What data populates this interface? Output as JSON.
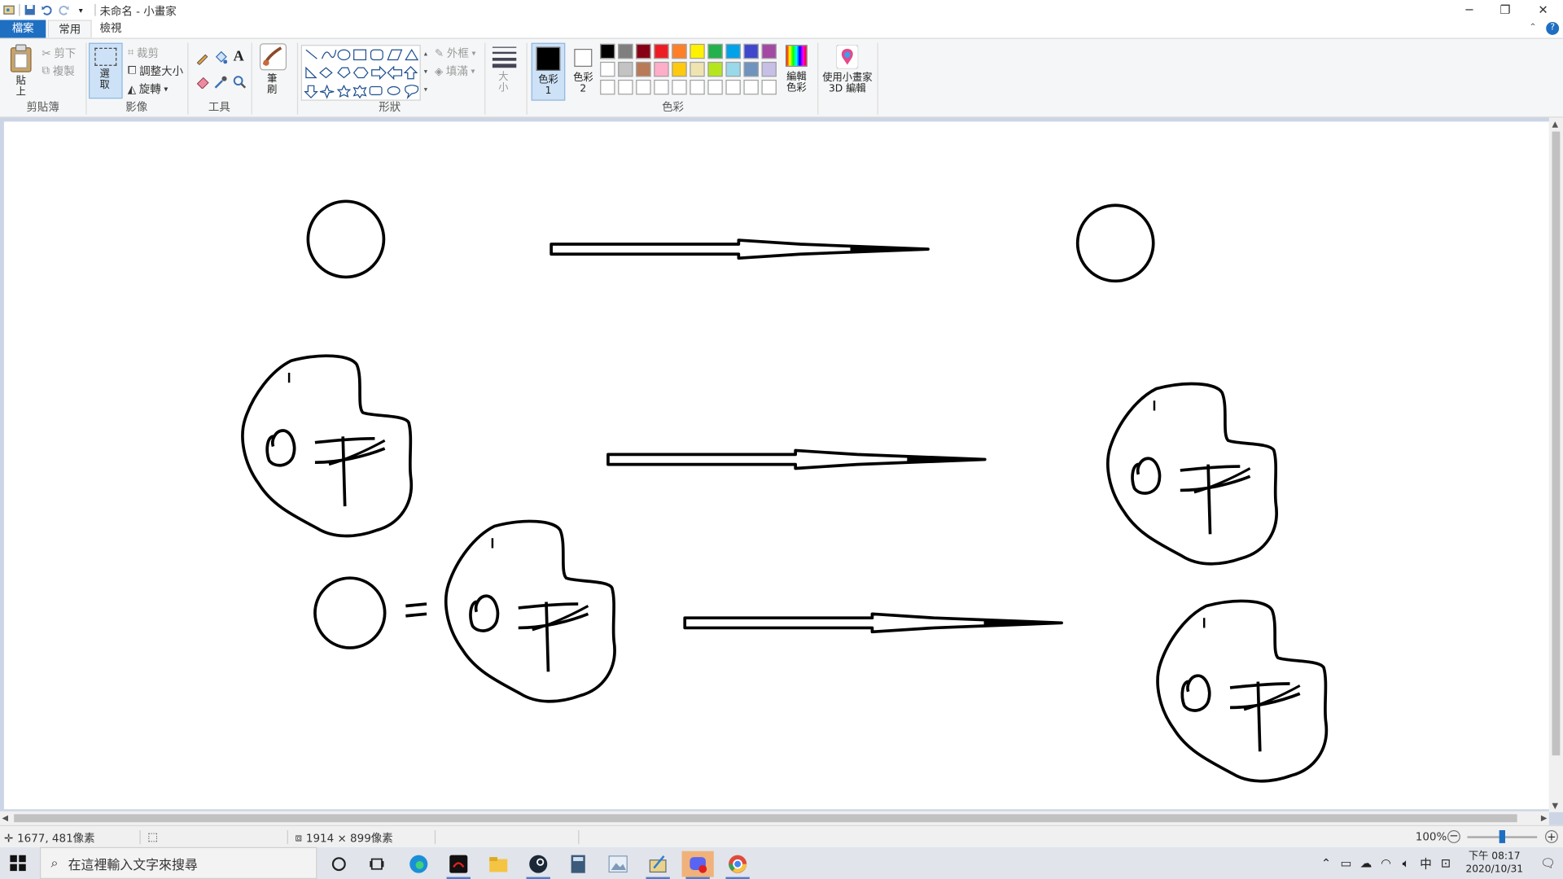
{
  "window": {
    "title": "未命名 - 小畫家",
    "minimize": "─",
    "restore": "❐",
    "close": "✕"
  },
  "tabs": {
    "file": "檔案",
    "home": "常用",
    "view": "檢視"
  },
  "ribbon": {
    "clipboard": {
      "label": "剪貼簿",
      "paste": "貼上",
      "cut": "剪下",
      "copy": "複製"
    },
    "image": {
      "label": "影像",
      "select": "選取",
      "crop": "裁剪",
      "resize": "調整大小",
      "rotate": "旋轉"
    },
    "tools": {
      "label": "工具"
    },
    "brushes": {
      "label": "筆刷"
    },
    "shapes": {
      "label": "形狀",
      "outline": "外框",
      "fill": "填滿"
    },
    "size": {
      "label": "大小"
    },
    "colors": {
      "label": "色彩",
      "color1": "色彩 1",
      "color2": "色彩 2",
      "edit": "編輯色彩",
      "row1": [
        "#000000",
        "#7f7f7f",
        "#880015",
        "#ed1c24",
        "#ff7f27",
        "#fff200",
        "#22b14c",
        "#00a2e8",
        "#3f48cc",
        "#a349a4"
      ],
      "row2": [
        "#ffffff",
        "#c3c3c3",
        "#b97a57",
        "#ffaec9",
        "#ffc90e",
        "#efe4b0",
        "#b5e61d",
        "#99d9ea",
        "#7092be",
        "#c8bfe7"
      ],
      "row3": [
        "#ffffff",
        "#ffffff",
        "#ffffff",
        "#ffffff",
        "#ffffff",
        "#ffffff",
        "#ffffff",
        "#ffffff",
        "#ffffff",
        "#ffffff"
      ]
    },
    "paint3d": {
      "label": "使用小畫家 3D 編輯"
    }
  },
  "status": {
    "cursor_pos": "1677, 481像素",
    "canvas_size": "1914 × 899像素",
    "zoom": "100%"
  },
  "taskbar": {
    "search_placeholder": "在這裡輸入文字來搜尋",
    "clock_time": "下午 08:17",
    "clock_date": "2020/10/31",
    "ime": "中"
  }
}
